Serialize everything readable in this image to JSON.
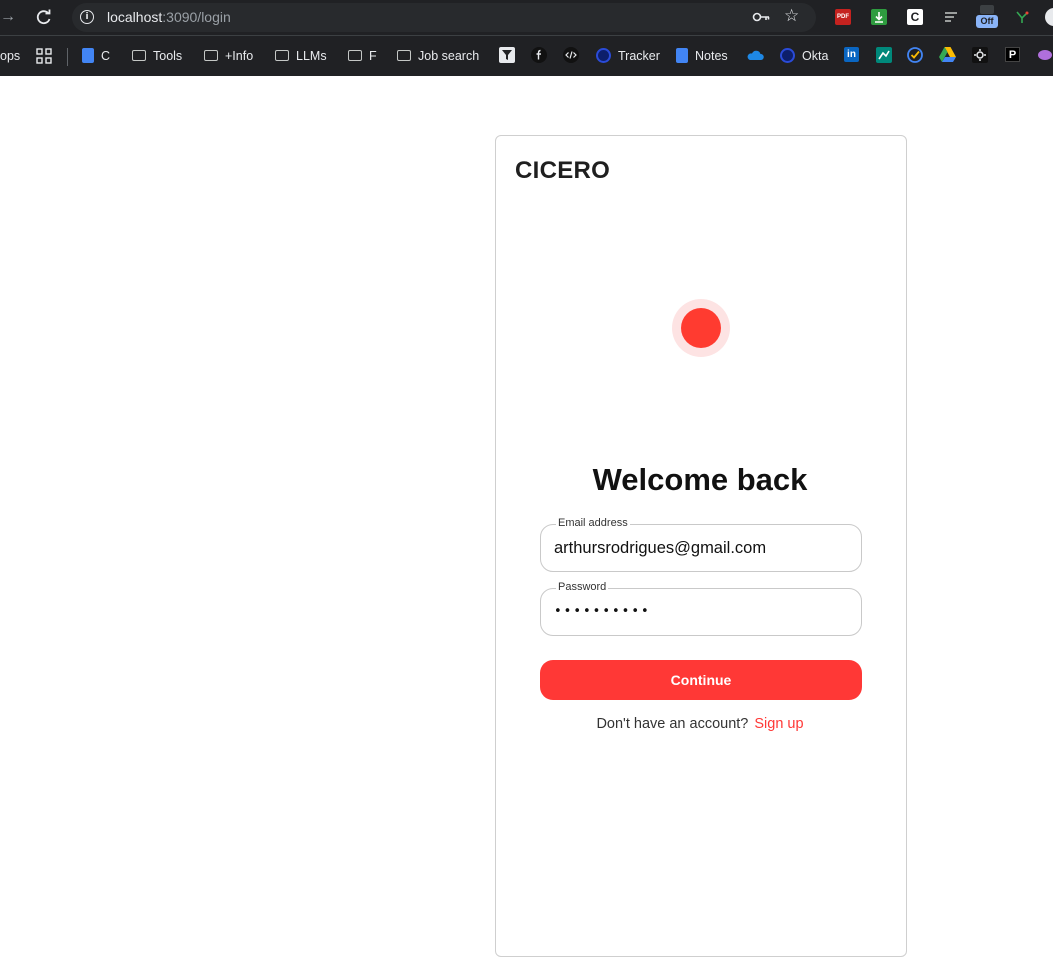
{
  "browser": {
    "url_host": "localhost",
    "url_path": ":3090/login",
    "ext_pdf_label": "PDF",
    "ext_c_label": "C",
    "ext_off_label": "Off",
    "bookmarks": {
      "apps": "ops",
      "c": "C",
      "tools": "Tools",
      "info": "+Info",
      "llms": "LLMs",
      "f": "F",
      "job_search": "Job search",
      "tracker": "Tracker",
      "notes": "Notes",
      "okta": "Okta",
      "linkedin": "in",
      "p": "P"
    }
  },
  "page": {
    "brand": "CICERO",
    "title": "Welcome back",
    "email": {
      "label": "Email address",
      "value": "arthursrodrigues@gmail.com"
    },
    "password": {
      "label": "Password",
      "masked_value": "••••••••••"
    },
    "continue_label": "Continue",
    "signup_prompt": "Don't have an account?",
    "signup_link": "Sign up"
  },
  "colors": {
    "accent": "#ff3836",
    "chrome_bg": "#202124"
  }
}
